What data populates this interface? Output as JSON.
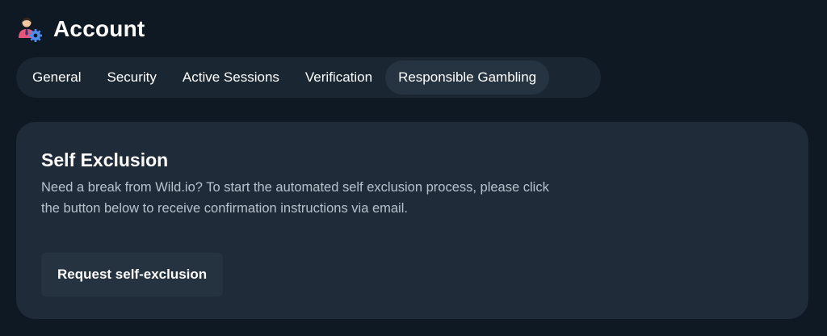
{
  "header": {
    "icon": "account-user-gear-icon",
    "title": "Account"
  },
  "tabs": [
    {
      "label": "General",
      "active": false
    },
    {
      "label": "Security",
      "active": false
    },
    {
      "label": "Active Sessions",
      "active": false
    },
    {
      "label": "Verification",
      "active": false
    },
    {
      "label": "Responsible Gambling",
      "active": true
    }
  ],
  "self_exclusion": {
    "title": "Self Exclusion",
    "description": "Need a break from Wild.io? To start the automated self exclusion process, please click the button below to receive confirmation instructions via email.",
    "button_label": "Request self-exclusion"
  },
  "colors": {
    "background": "#0f1923",
    "tab_bar": "#1a2632",
    "active_tab": "#263442",
    "card": "#1f2b38",
    "icon_accent_pink": "#e8547a",
    "icon_accent_blue": "#4d8df0"
  }
}
